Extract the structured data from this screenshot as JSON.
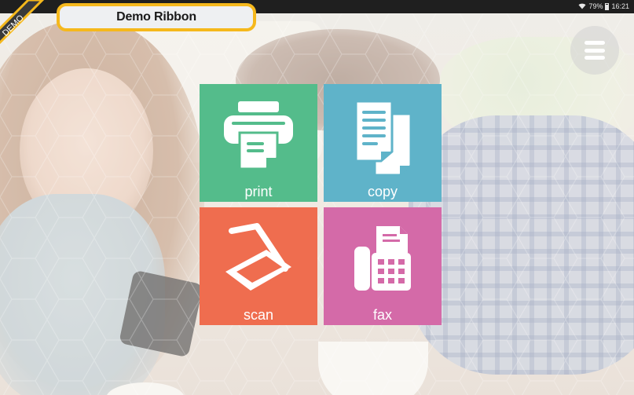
{
  "status_bar": {
    "battery": "79%",
    "time": "16:21"
  },
  "ribbon": {
    "demo_label": "DEMO",
    "title": "Demo Ribbon"
  },
  "menu": {
    "icon": "hamburger-menu-icon"
  },
  "tiles": [
    {
      "id": "print",
      "label": "print",
      "icon": "printer-icon",
      "color": "#54bc8b"
    },
    {
      "id": "copy",
      "label": "copy",
      "icon": "copy-documents-icon",
      "color": "#5fb3c9"
    },
    {
      "id": "scan",
      "label": "scan",
      "icon": "scanner-icon",
      "color": "#ef6d4f"
    },
    {
      "id": "fax",
      "label": "fax",
      "icon": "fax-machine-icon",
      "color": "#d46aa8"
    }
  ]
}
